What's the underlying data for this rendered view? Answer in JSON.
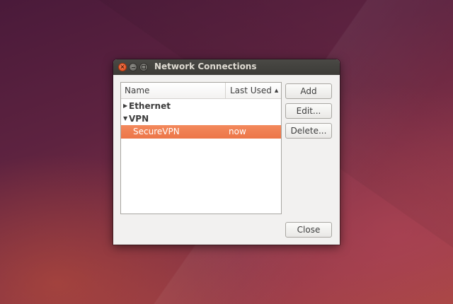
{
  "window": {
    "title": "Network Connections",
    "controls": {
      "close_glyph": "×"
    }
  },
  "list": {
    "columns": {
      "name": "Name",
      "last_used": "Last Used",
      "sort_indicator": "▲"
    },
    "groups": [
      {
        "label": "Ethernet",
        "expanded": false,
        "expander": "▶"
      },
      {
        "label": "VPN",
        "expanded": true,
        "expander": "▼"
      }
    ],
    "connections": [
      {
        "name": "SecureVPN",
        "last_used": "now",
        "selected": true
      }
    ]
  },
  "buttons": {
    "add": "Add",
    "edit": "Edit...",
    "delete": "Delete...",
    "close": "Close"
  },
  "colors": {
    "selection": "#ec7648",
    "titlebar": "#3c3b37",
    "close_button": "#df4a16"
  }
}
